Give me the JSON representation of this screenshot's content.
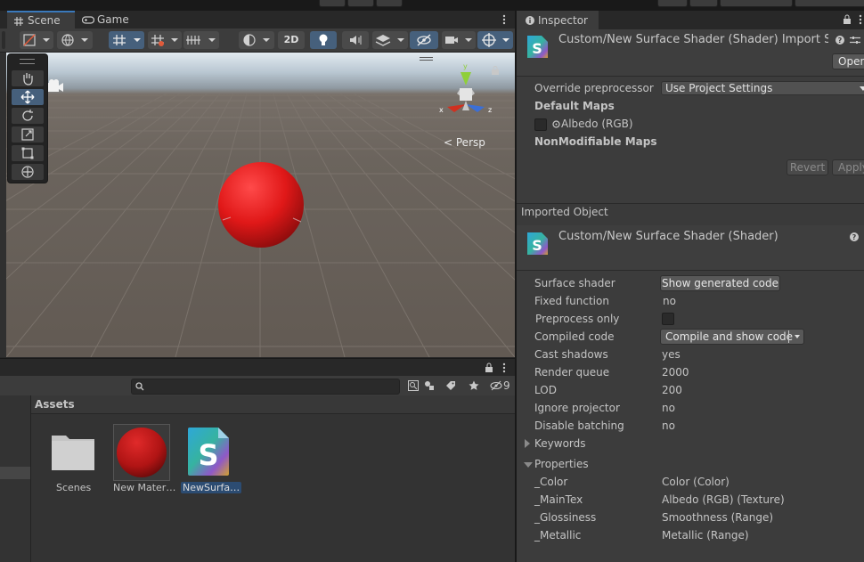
{
  "scene_window": {
    "tabs": [
      {
        "label": "Scene",
        "icon": "grid-icon",
        "active": true
      },
      {
        "label": "Game",
        "icon": "gamepad-icon",
        "active": false
      }
    ],
    "toolbar_2d": "2D",
    "viewport": {
      "persp_label": "Persp",
      "gizmo_axes": [
        "x",
        "y",
        "z"
      ],
      "toolbox_tools": [
        "hand-tool",
        "move-tool",
        "rotate-tool",
        "scale-tool",
        "rect-tool",
        "transform-tool"
      ]
    }
  },
  "project_window": {
    "hidden_count": "9",
    "assets_title": "Assets",
    "items": [
      {
        "label": "Scenes",
        "icon": "folder-icon",
        "selected": false
      },
      {
        "label": "New Mater…",
        "icon": "material-sphere-icon",
        "selected": false
      },
      {
        "label": "NewSurfa…",
        "icon": "shader-icon",
        "selected": true
      }
    ]
  },
  "inspector": {
    "tab_label": "Inspector",
    "import_header": {
      "title": "Custom/New Surface Shader (Shader) Import Se",
      "open_button": "Open"
    },
    "override_preprocessor": {
      "label": "Override preprocessor",
      "value": "Use Project Settings"
    },
    "default_maps_label": "Default Maps",
    "albedo_label": "Albedo (RGB)",
    "nonmodifiable_label": "NonModifiable Maps",
    "revert_button": "Revert",
    "apply_button": "Apply",
    "imported_object_label": "Imported Object",
    "shader_header_title": "Custom/New Surface Shader (Shader)",
    "fields": {
      "surface_shader": {
        "label": "Surface shader",
        "button": "Show generated code"
      },
      "fixed_function": {
        "label": "Fixed function",
        "value": "no"
      },
      "preprocess_only": {
        "label": "Preprocess only"
      },
      "compiled_code": {
        "label": "Compiled code",
        "button": "Compile and show code"
      },
      "cast_shadows": {
        "label": "Cast shadows",
        "value": "yes"
      },
      "render_queue": {
        "label": "Render queue",
        "value": "2000"
      },
      "lod": {
        "label": "LOD",
        "value": "200"
      },
      "ignore_projector": {
        "label": "Ignore projector",
        "value": "no"
      },
      "disable_batching": {
        "label": "Disable batching",
        "value": "no"
      }
    },
    "keywords_label": "Keywords",
    "properties_label": "Properties",
    "properties": [
      {
        "name": "_Color",
        "value": "Color (Color)"
      },
      {
        "name": "_MainTex",
        "value": "Albedo (RGB) (Texture)"
      },
      {
        "name": "_Glossiness",
        "value": "Smoothness (Range)"
      },
      {
        "name": "_Metallic",
        "value": "Metallic (Range)"
      }
    ]
  },
  "colors": {
    "selection_blue": "#46607c",
    "sphere_red": "#e02020"
  }
}
